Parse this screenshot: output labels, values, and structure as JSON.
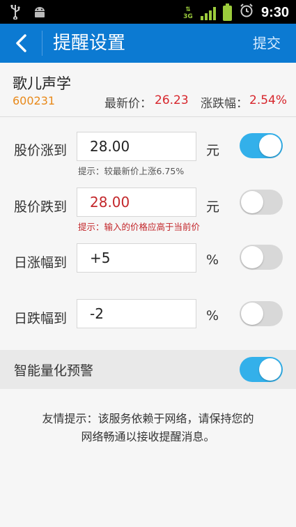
{
  "status_bar": {
    "time": "9:30",
    "network": "3G",
    "usb_icon": "usb-icon",
    "android_icon": "android-icon"
  },
  "header": {
    "title": "提醒设置",
    "submit_label": "提交",
    "back_icon": "back-arrow-icon"
  },
  "stock": {
    "name": "歌儿声学",
    "code": "600231",
    "price_label": "最新价：",
    "price_value": "26.23",
    "change_label": "涨跌幅：",
    "change_value": "2.54%"
  },
  "rows": [
    {
      "label": "股价涨到",
      "value": "28.00",
      "unit": "元",
      "hint": "提示：较最新价上涨6.75%",
      "enabled": true
    },
    {
      "label": "股价跌到",
      "value": "28.00",
      "unit": "元",
      "hint": "提示：输入的价格应高于当前价",
      "enabled": false
    },
    {
      "label": "日涨幅到",
      "value": "+5",
      "unit": "%",
      "enabled": false
    },
    {
      "label": "日跌幅到",
      "value": "-2",
      "unit": "%",
      "enabled": false
    }
  ],
  "smart_alert": {
    "label": "智能量化预警",
    "enabled": true
  },
  "notice": {
    "line1": "友情提示：该服务依赖于网络，请保持您的",
    "line2": "网络畅通以接收提醒消息。"
  },
  "colors": {
    "header": "#0c7ad2",
    "toggle_on": "#33b0ea",
    "price_red": "#d7262c",
    "code_orange": "#e8891a"
  }
}
